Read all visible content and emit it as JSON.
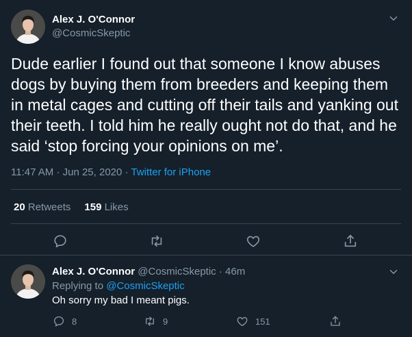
{
  "main_tweet": {
    "author_name": "Alex J. O'Connor",
    "author_handle": "@CosmicSkeptic",
    "text": "Dude earlier I found out that someone I know abuses dogs by buying them from breeders and keeping them in metal cages and cutting off their tails and yanking out their teeth. I told him he really ought not do that, and he said ‘stop forcing your opinions on me’.",
    "time": "11:47 AM",
    "date": "Jun 25, 2020",
    "dot": " · ",
    "source": "Twitter for iPhone",
    "retweets_count": "20",
    "retweets_label": "Retweets",
    "likes_count": "159",
    "likes_label": "Likes",
    "icons": [
      "chevron-down-icon",
      "reply-icon",
      "retweet-icon",
      "like-icon",
      "share-icon"
    ]
  },
  "reply_tweet": {
    "author_name": "Alex J. O'Connor",
    "author_handle": "@CosmicSkeptic",
    "time_ago": "46m",
    "replying_prefix": "Replying to",
    "replying_to": "@CosmicSkeptic",
    "text": "Oh sorry my bad I meant pigs.",
    "reply_count": "8",
    "retweet_count": "9",
    "like_count": "151"
  },
  "colors": {
    "background": "#15202b",
    "text_primary": "#ffffff",
    "text_secondary": "#8899a6",
    "accent": "#1da1f2",
    "divider": "#38444d"
  }
}
